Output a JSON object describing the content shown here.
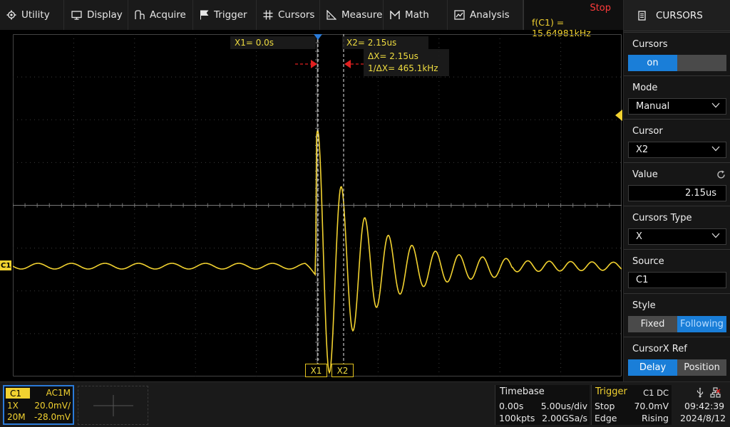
{
  "menu": {
    "items": [
      {
        "label": "Utility",
        "icon": "gear-icon"
      },
      {
        "label": "Display",
        "icon": "monitor-icon"
      },
      {
        "label": "Acquire",
        "icon": "acquire-icon"
      },
      {
        "label": "Trigger",
        "icon": "flag-icon"
      },
      {
        "label": "Cursors",
        "icon": "crosshair-icon"
      },
      {
        "label": "Measure",
        "icon": "measure-icon"
      },
      {
        "label": "Math",
        "icon": "math-icon"
      },
      {
        "label": "Analysis",
        "icon": "analysis-icon"
      }
    ]
  },
  "status": {
    "run_state": "Stop",
    "frequency": "f(C1) = 15.64981kHz"
  },
  "panel": {
    "title": "CURSORS",
    "cursors_label": "Cursors",
    "cursors_on": "on",
    "mode_label": "Mode",
    "mode_value": "Manual",
    "cursor_label": "Cursor",
    "cursor_value": "X2",
    "value_label": "Value",
    "value_value": "2.15us",
    "type_label": "Cursors Type",
    "type_value": "X",
    "source_label": "Source",
    "source_value": "C1",
    "style_label": "Style",
    "style_fixed": "Fixed",
    "style_following": "Following",
    "ref_label": "CursorX Ref",
    "ref_delay": "Delay",
    "ref_position": "Position"
  },
  "cursors": {
    "x1_label": "X1= 0.0s",
    "x2_label": "X2= 2.15us",
    "delta_x": "ΔX= 2.15us",
    "inv_delta_x": "1/ΔX= 465.1kHz",
    "x1_marker": "X1",
    "x2_marker": "X2"
  },
  "channel": {
    "marker": "C1",
    "name": "C1",
    "coupling": "AC1M",
    "probe": "1X",
    "scale": "20.0mV/",
    "bandwidth": "20M",
    "offset": "-28.0mV"
  },
  "timebase": {
    "title": "Timebase",
    "delay": "0.00s",
    "scale": "5.00us/div",
    "memory": "100kpts",
    "sample_rate": "2.00GSa/s"
  },
  "trigger": {
    "title": "Trigger",
    "source_coupling": "C1 DC",
    "state": "Stop",
    "level": "70.0mV",
    "type": "Edge",
    "slope": "Rising"
  },
  "clock": {
    "time": "09:42:39",
    "date": "2024/8/12"
  },
  "colors": {
    "trace": "#f2d230",
    "accent": "#1a7ed8",
    "stop": "#ff3b3b"
  }
}
